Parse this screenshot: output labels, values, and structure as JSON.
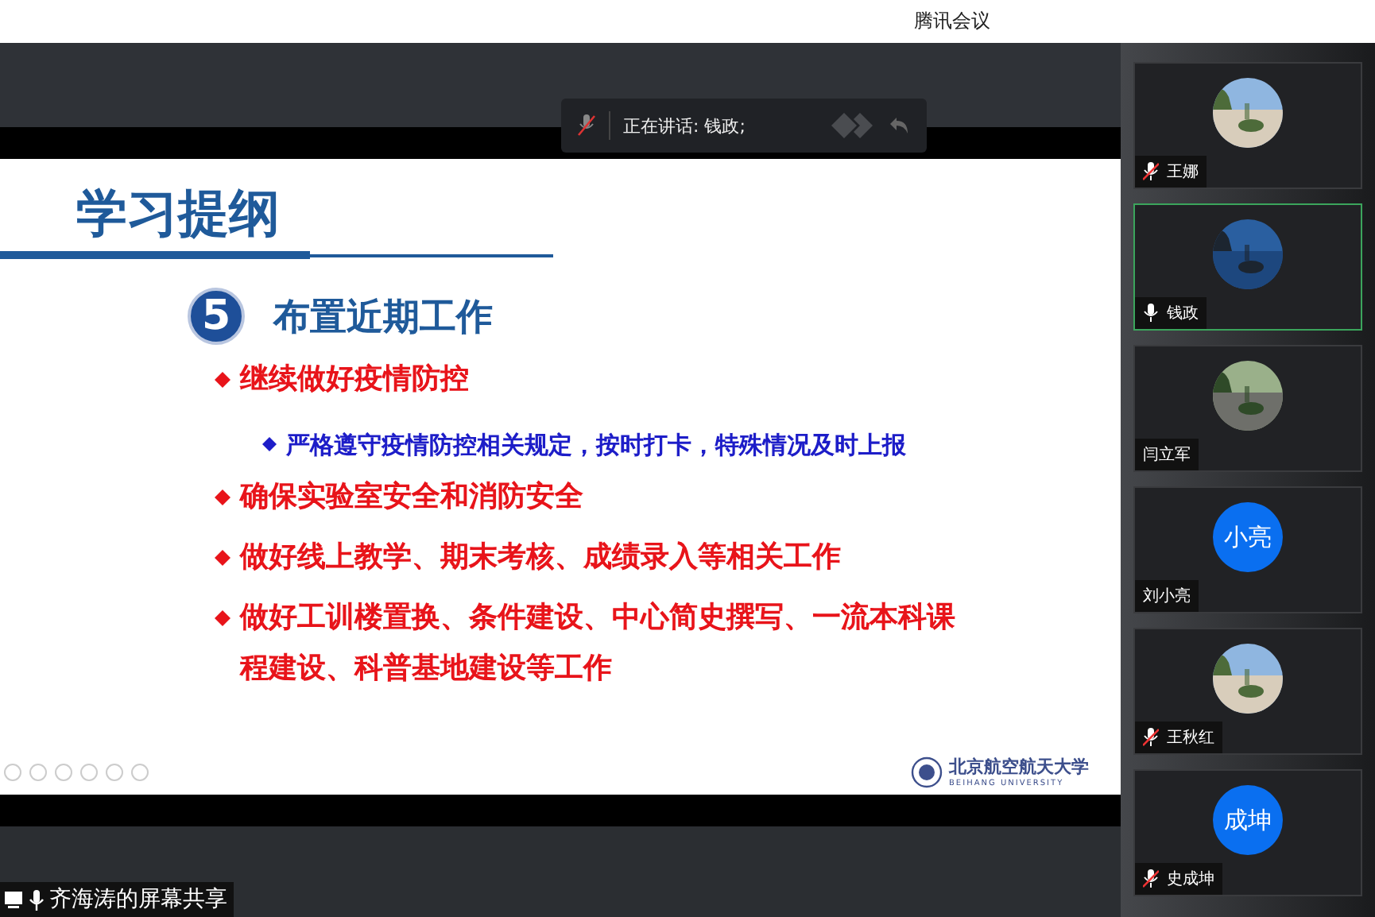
{
  "window": {
    "title": "腾讯会议"
  },
  "speaker_bar": {
    "muted": true,
    "text": "正在讲话: 钱政;"
  },
  "slide": {
    "title": "学习提纲",
    "section_number": "5",
    "section_title": "布置近期工作",
    "bullets": [
      {
        "kind": "main",
        "text": "继续做好疫情防控"
      },
      {
        "kind": "sub",
        "text": "严格遵守疫情防控相关规定，按时打卡，特殊情况及时上报"
      },
      {
        "kind": "main",
        "text": "确保实验室安全和消防安全"
      },
      {
        "kind": "main",
        "text": "做好线上教学、期末考核、成绩录入等相关工作"
      },
      {
        "kind": "main",
        "text": "做好工训楼置换、条件建设、中心简史撰写、一流本科课程建设、科普基地建设等工作"
      }
    ],
    "logo_text": "北京航空航天大学",
    "logo_subtext": "BEIHANG UNIVERSITY"
  },
  "share_label": {
    "text": "齐海涛的屏幕共享"
  },
  "participants": [
    {
      "name": "王娜",
      "mic": {
        "muted": true
      },
      "speaking": false
    },
    {
      "name": "钱政",
      "mic": {
        "muted": false
      },
      "speaking": true
    },
    {
      "name": "闫立军",
      "speaking": false
    },
    {
      "name": "刘小亮",
      "speaking": false,
      "avatar": {
        "kind": "initials",
        "initials": "小亮"
      }
    },
    {
      "name": "王秋红",
      "mic": {
        "muted": true
      },
      "speaking": false
    },
    {
      "name": "史成坤",
      "mic": {
        "muted": true
      },
      "speaking": false,
      "avatar": {
        "kind": "initials",
        "initials": "成坤"
      }
    }
  ]
}
